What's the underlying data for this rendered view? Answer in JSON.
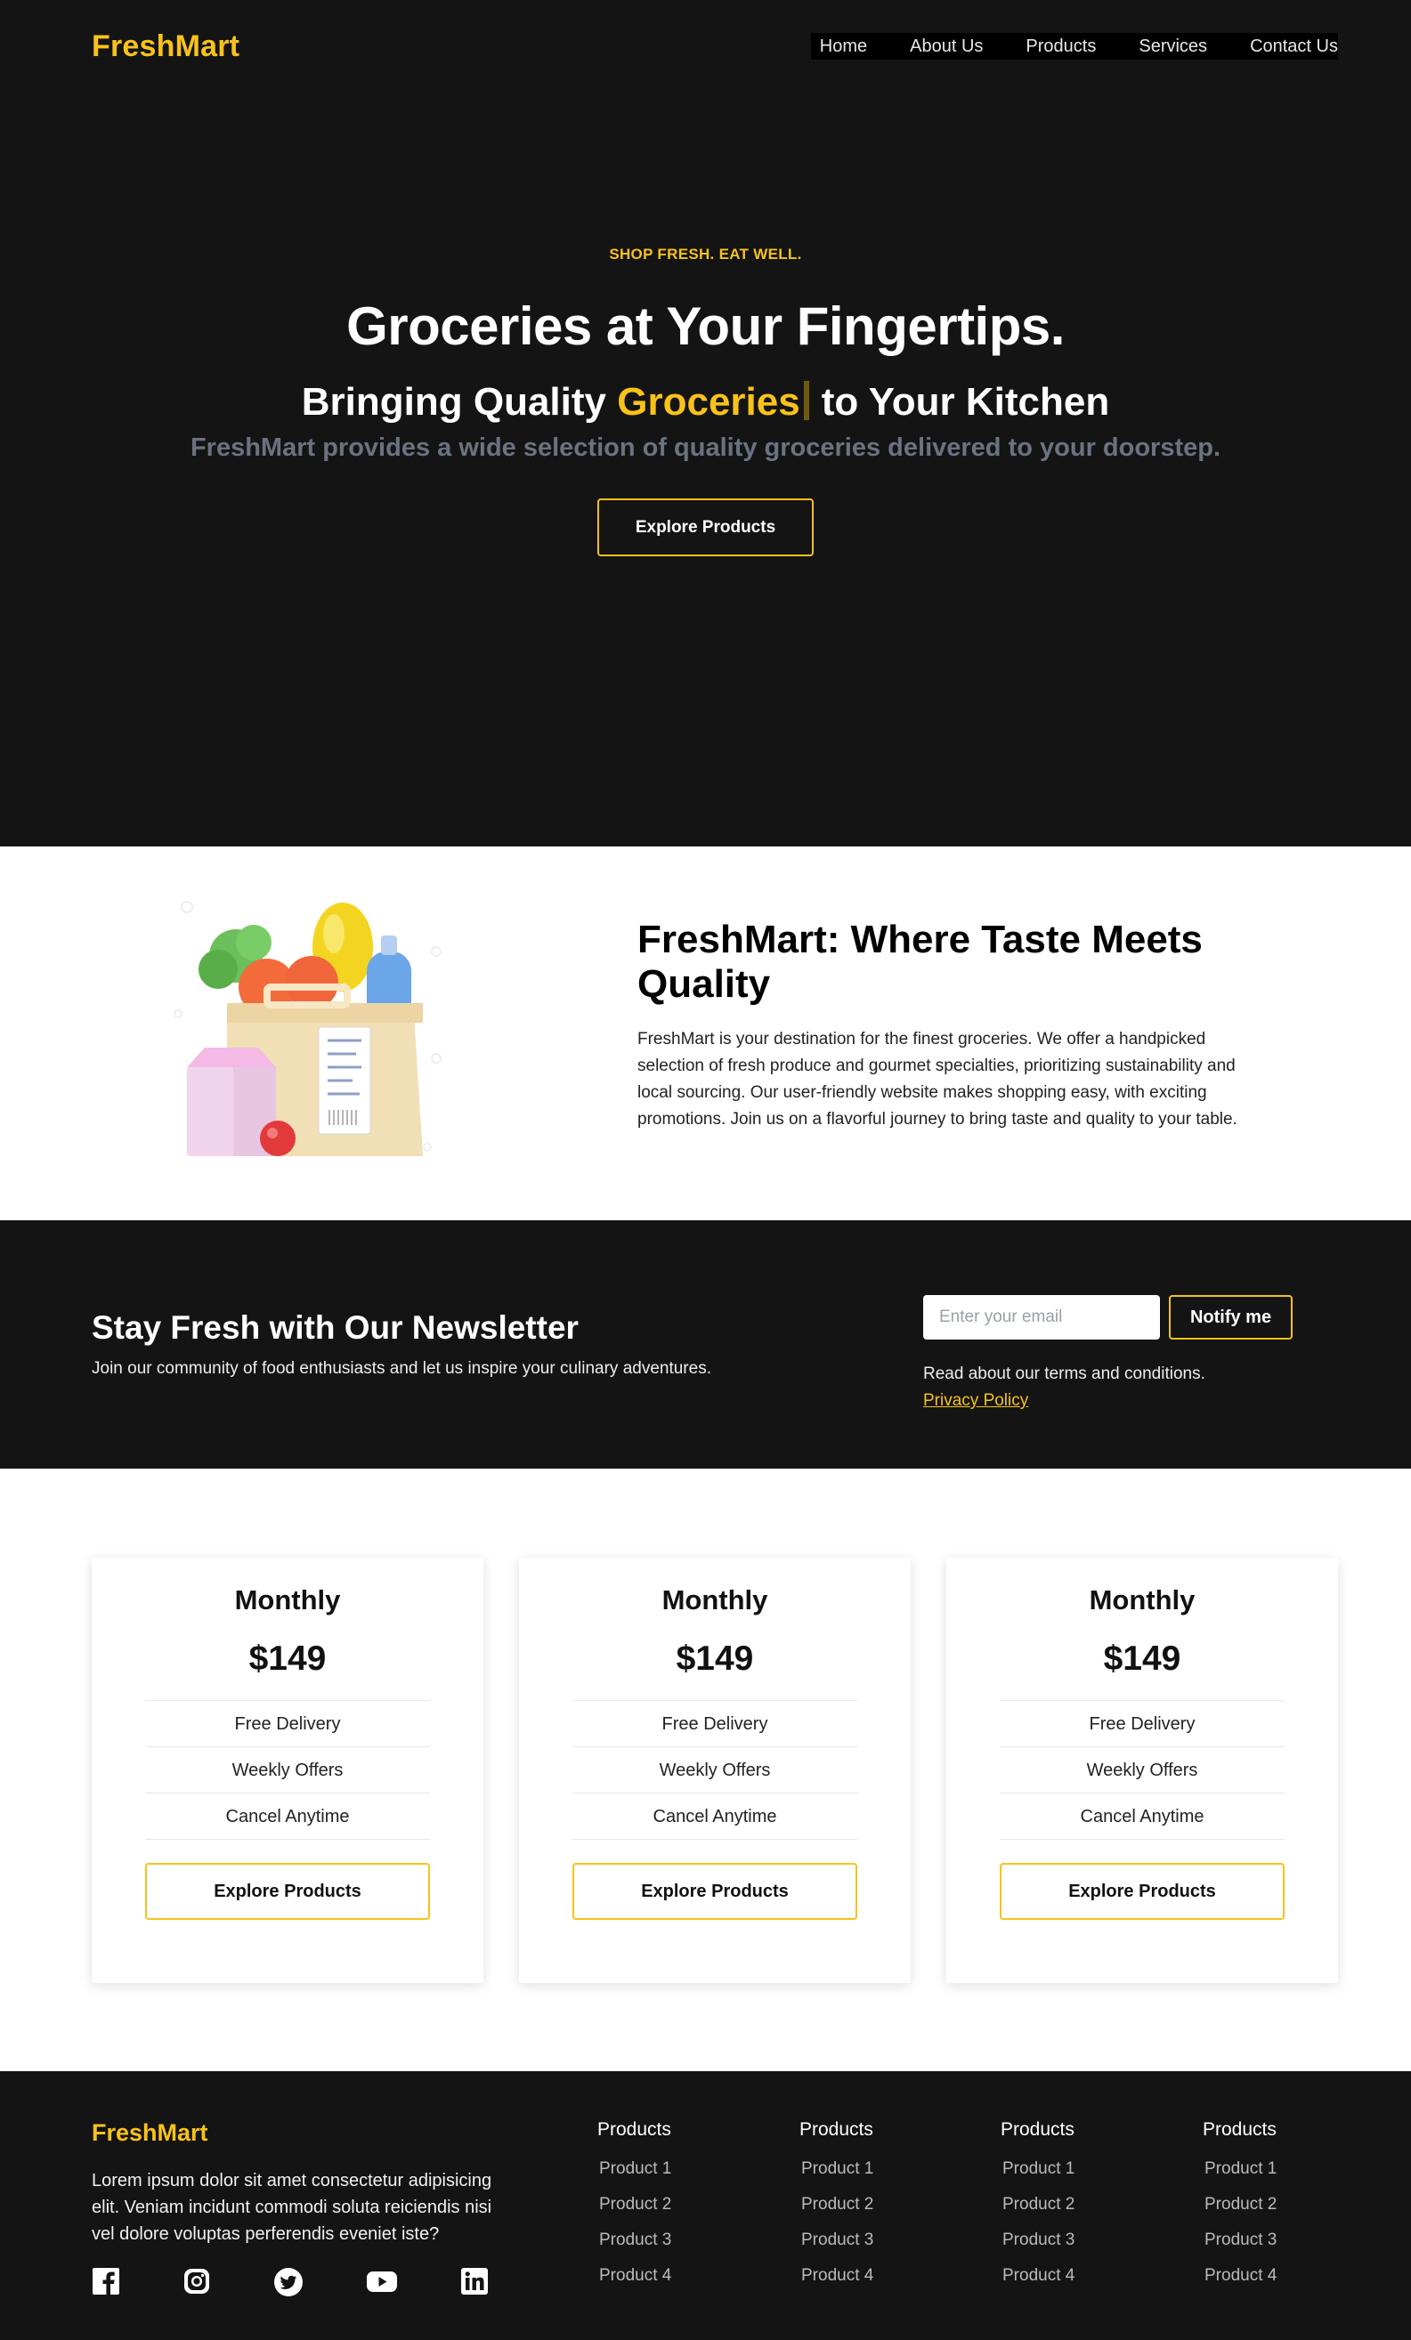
{
  "brand": {
    "name": "FreshMart",
    "accent": "#f8c21a",
    "dark_bg": "#141414"
  },
  "nav": {
    "items": [
      "Home",
      "About Us",
      "Products",
      "Services",
      "Contact Us"
    ]
  },
  "hero": {
    "eyebrow": "SHOP FRESH. EAT WELL.",
    "title": "Groceries at Your Fingertips.",
    "sub_before": "Bringing Quality",
    "sub_highlight": "Groceries",
    "sub_after": "to Your Kitchen",
    "description": "FreshMart provides a wide selection of quality groceries delivered to your doorstep.",
    "button": "Explore Products"
  },
  "about": {
    "title": "FreshMart: Where Taste Meets Quality",
    "body": "FreshMart is your destination for the finest groceries. We offer a handpicked selection of fresh produce and gourmet specialties, prioritizing sustainability and local sourcing. Our user-friendly website makes shopping easy, with exciting promotions. Join us on a flavorful journey to bring taste and quality to your table."
  },
  "newsletter": {
    "title": "Stay Fresh with Our Newsletter",
    "subtitle": "Join our community of food enthusiasts and let us inspire your culinary adventures.",
    "email_placeholder": "Enter your email",
    "button": "Notify me",
    "terms": "Read about our terms and conditions.",
    "policy_link": "Privacy Policy"
  },
  "pricing": {
    "plans": [
      {
        "title": "Monthly",
        "price": "$149",
        "features": [
          "Free Delivery",
          "Weekly Offers",
          "Cancel Anytime"
        ],
        "button": "Explore Products"
      },
      {
        "title": "Monthly",
        "price": "$149",
        "features": [
          "Free Delivery",
          "Weekly Offers",
          "Cancel Anytime"
        ],
        "button": "Explore Products"
      },
      {
        "title": "Monthly",
        "price": "$149",
        "features": [
          "Free Delivery",
          "Weekly Offers",
          "Cancel Anytime"
        ],
        "button": "Explore Products"
      }
    ]
  },
  "footer": {
    "logo": "FreshMart",
    "description": "Lorem ipsum dolor sit amet consectetur adipisicing elit. Veniam incidunt commodi soluta reiciendis nisi vel dolore voluptas perferendis eveniet iste?",
    "social_icons": [
      "facebook-icon",
      "instagram-icon",
      "twitter-icon",
      "youtube-icon",
      "linkedin-icon"
    ],
    "columns": [
      {
        "heading": "Products",
        "links": [
          "Product 1",
          "Product 2",
          "Product 3",
          "Product 4"
        ]
      },
      {
        "heading": "Products",
        "links": [
          "Product 1",
          "Product 2",
          "Product 3",
          "Product 4"
        ]
      },
      {
        "heading": "Products",
        "links": [
          "Product 1",
          "Product 2",
          "Product 3",
          "Product 4"
        ]
      },
      {
        "heading": "Products",
        "links": [
          "Product 1",
          "Product 2",
          "Product 3",
          "Product 4"
        ]
      }
    ]
  }
}
